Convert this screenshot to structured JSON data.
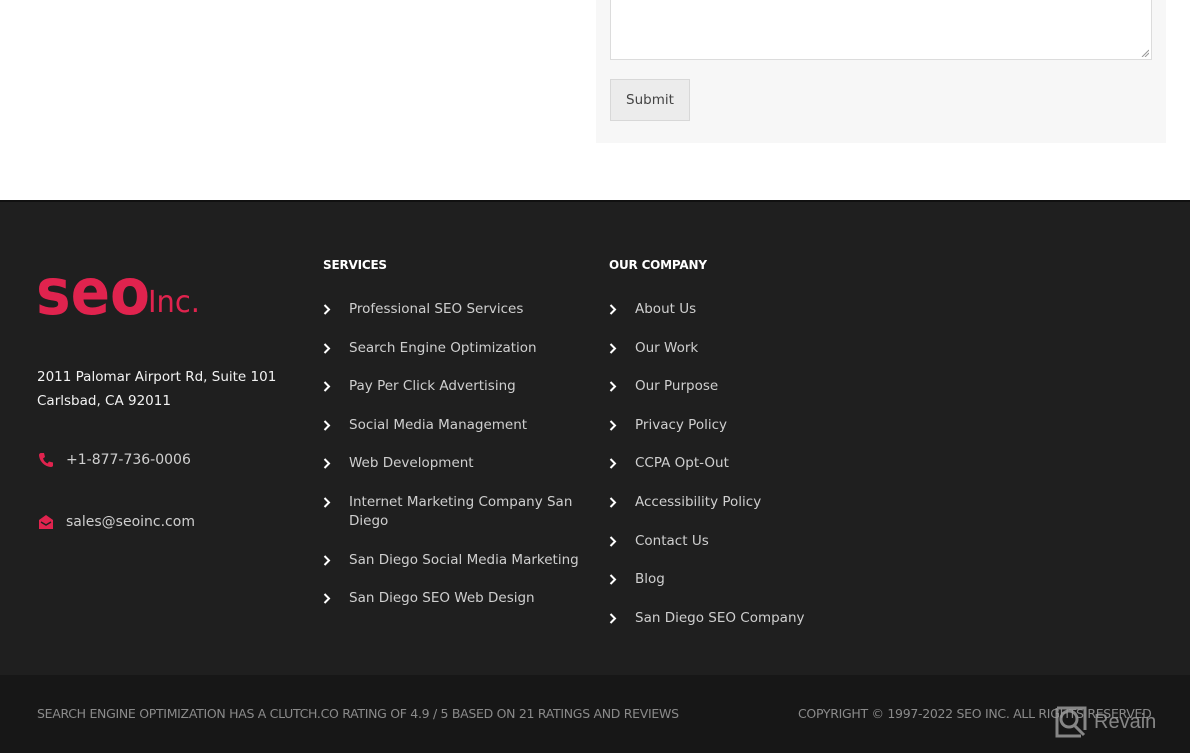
{
  "form": {
    "submit_label": "Submit"
  },
  "brand": {
    "logo_main": "seo",
    "logo_suffix": "Inc.",
    "accent_color": "#e0234e"
  },
  "contact": {
    "address_line1": "2011 Palomar Airport Rd, Suite 101",
    "address_line2": "Carlsbad, CA 92011",
    "phone": "+1-877-736-0006",
    "phone_icon": "phone-icon",
    "email": "sales@seoinc.com",
    "email_icon": "envelope-open-icon"
  },
  "services": {
    "title": "SERVICES",
    "items": [
      {
        "label": "Professional SEO Services"
      },
      {
        "label": "Search Engine Optimization"
      },
      {
        "label": "Pay Per Click Advertising"
      },
      {
        "label": "Social Media Management"
      },
      {
        "label": "Web Development"
      },
      {
        "label": "Internet Marketing Company San Diego"
      },
      {
        "label": "San Diego Social Media Marketing"
      },
      {
        "label": "San Diego SEO Web Design"
      }
    ]
  },
  "company": {
    "title": "OUR COMPANY",
    "items": [
      {
        "label": "About Us"
      },
      {
        "label": "Our Work"
      },
      {
        "label": "Our Purpose"
      },
      {
        "label": "Privacy Policy"
      },
      {
        "label": "CCPA Opt-Out"
      },
      {
        "label": "Accessibility Policy"
      },
      {
        "label": "Contact Us"
      },
      {
        "label": "Blog"
      },
      {
        "label": "San Diego SEO Company"
      }
    ]
  },
  "bottom": {
    "rating_text": "SEARCH ENGINE OPTIMIZATION HAS A CLUTCH.CO RATING OF 4.9 / 5 BASED ON 21 RATINGS AND REVIEWS",
    "copyright_text": "COPYRIGHT © 1997-2022 SEO INC. ALL RIGHTS RESERVED",
    "watermark_text": "Revain"
  }
}
